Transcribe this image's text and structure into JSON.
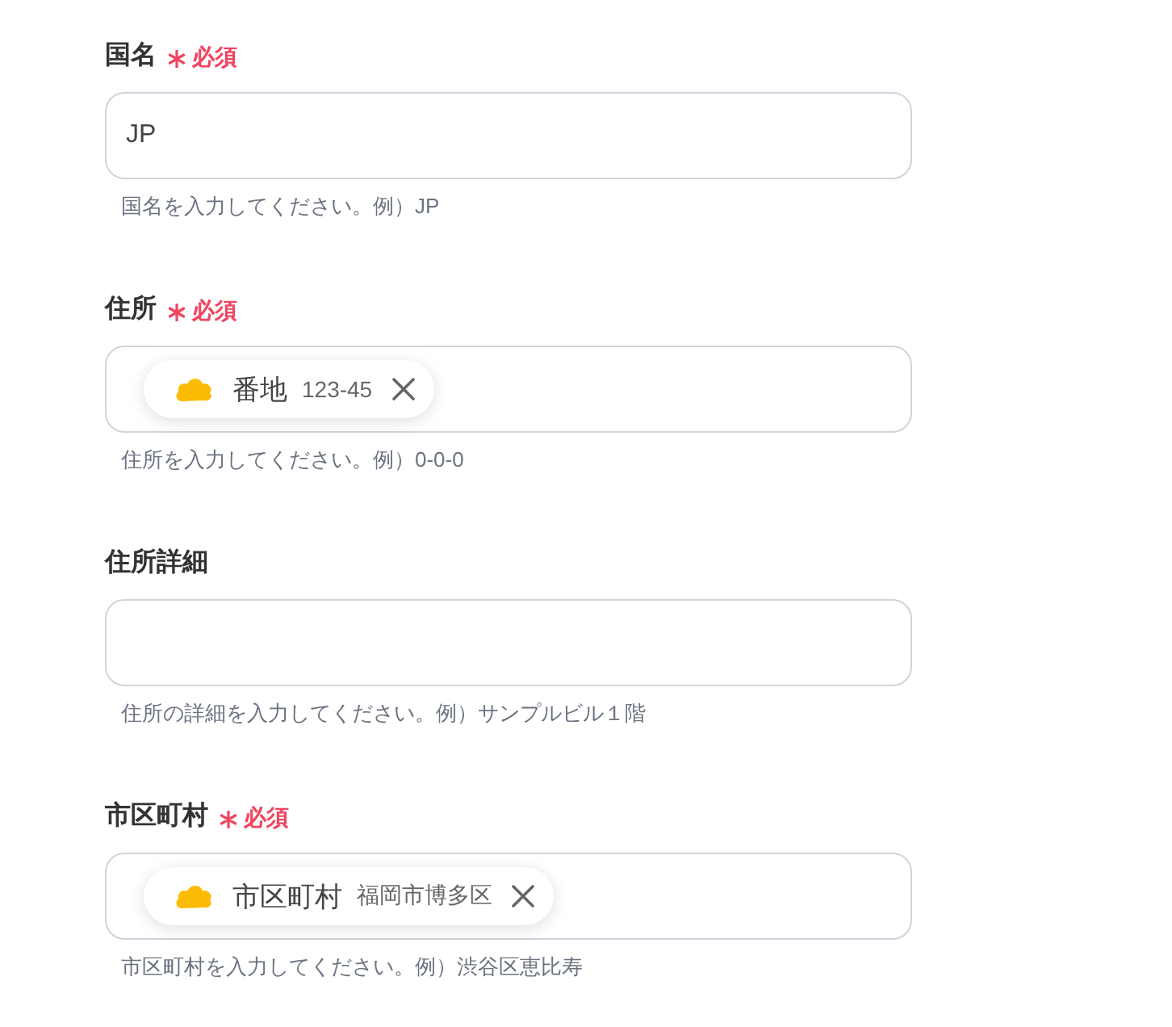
{
  "fields": [
    {
      "label": "国名",
      "required": true,
      "required_mark": "必須",
      "kind": "text",
      "value": "JP",
      "hint": "国名を入力してください。例）JP"
    },
    {
      "label": "住所",
      "required": true,
      "required_mark": "必須",
      "kind": "chips",
      "chips": [
        {
          "name": "番地",
          "value": "123-45"
        }
      ],
      "hint": "住所を入力してください。例）0-0-0"
    },
    {
      "label": "住所詳細",
      "required": false,
      "kind": "text",
      "hint": "住所の詳細を入力してください。例）サンプルビル１階"
    },
    {
      "label": "市区町村",
      "required": true,
      "required_mark": "必須",
      "kind": "chips",
      "chips": [
        {
          "name": "市区町村",
          "value": "福岡市博多区"
        }
      ],
      "hint": "市区町村を入力してください。例）渋谷区恵比寿"
    }
  ]
}
